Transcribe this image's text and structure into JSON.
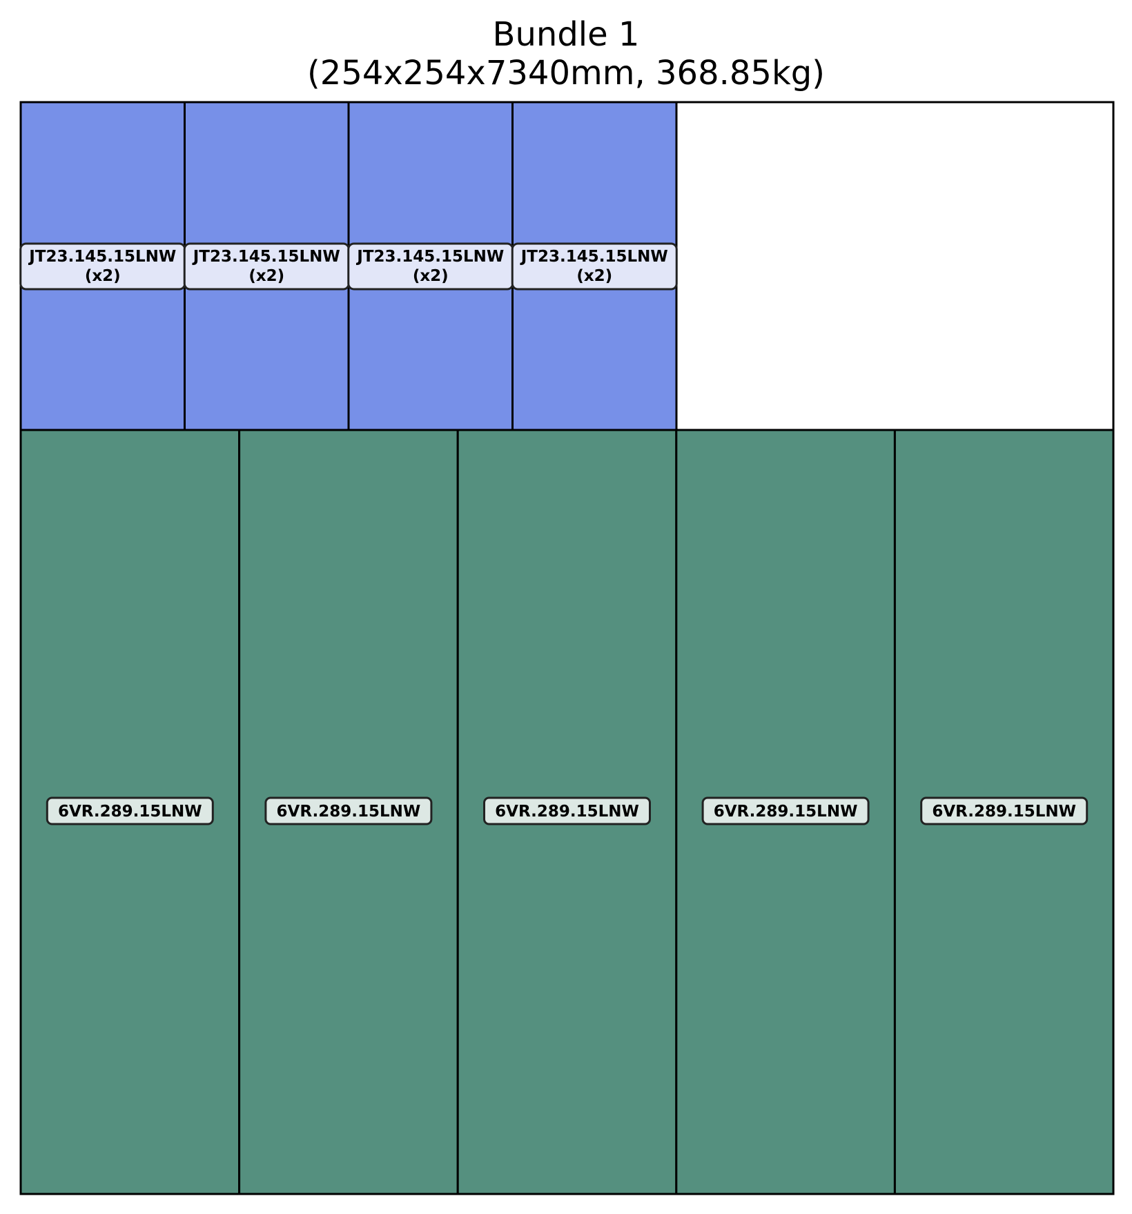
{
  "title": {
    "line1": "Bundle 1",
    "line2": "(254x254x7340mm, 368.85kg)"
  },
  "colors": {
    "top_fill": "#7790E8",
    "bottom_fill": "#55907F",
    "label_top_bg": "#E2E6F8",
    "label_bottom_bg": "#DDE8E4",
    "outline": "#000000",
    "empty": "#FFFFFF"
  },
  "top_row": [
    {
      "name": "JT23.145.15LNW",
      "qty": "(x2)"
    },
    {
      "name": "JT23.145.15LNW",
      "qty": "(x2)"
    },
    {
      "name": "JT23.145.15LNW",
      "qty": "(x2)"
    },
    {
      "name": "JT23.145.15LNW",
      "qty": "(x2)"
    }
  ],
  "bottom_row": [
    {
      "name": "6VR.289.15LNW"
    },
    {
      "name": "6VR.289.15LNW"
    },
    {
      "name": "6VR.289.15LNW"
    },
    {
      "name": "6VR.289.15LNW"
    },
    {
      "name": "6VR.289.15LNW"
    }
  ]
}
